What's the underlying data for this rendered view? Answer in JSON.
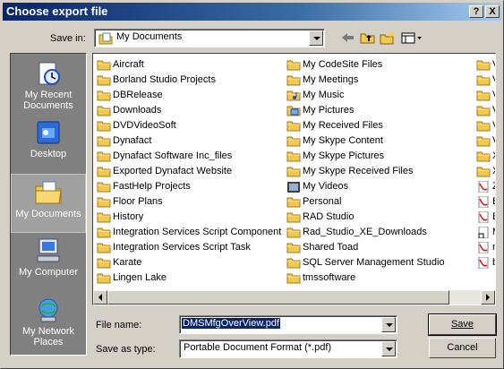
{
  "window": {
    "title": "Choose export file"
  },
  "title_buttons": {
    "help": "?",
    "close": "X"
  },
  "save_in": {
    "label": "Save in:",
    "value": "My Documents"
  },
  "toolbar": [
    "back-icon",
    "up-folder-icon",
    "new-folder-icon",
    "view-menu-icon"
  ],
  "places": [
    {
      "label": "My Recent Documents",
      "icon": "recent-documents-icon"
    },
    {
      "label": "Desktop",
      "icon": "desktop-icon"
    },
    {
      "label": "My Documents",
      "icon": "my-documents-icon"
    },
    {
      "label": "My Computer",
      "icon": "my-computer-icon"
    },
    {
      "label": "My Network Places",
      "icon": "network-places-icon"
    }
  ],
  "files": {
    "col1": [
      "Aircraft",
      "Borland Studio Projects",
      "DBRelease",
      "Downloads",
      "DVDVideoSoft",
      "Dynafact",
      "Dynafact Software Inc_files",
      "Exported Dynafact Website",
      "FastHelp Projects",
      "Floor Plans",
      "History",
      "Integration Services Script Component",
      "Integration Services Script Task",
      "Karate",
      "Lingen Lake"
    ],
    "col2": [
      {
        "name": "My CodeSite Files",
        "icon": "folder"
      },
      {
        "name": "My Meetings",
        "icon": "folder"
      },
      {
        "name": "My Music",
        "icon": "music"
      },
      {
        "name": "My Pictures",
        "icon": "pictures"
      },
      {
        "name": "My Received Files",
        "icon": "folder"
      },
      {
        "name": "My Skype Content",
        "icon": "folder"
      },
      {
        "name": "My Skype Pictures",
        "icon": "folder"
      },
      {
        "name": "My Skype Received Files",
        "icon": "folder"
      },
      {
        "name": "My Videos",
        "icon": "videos"
      },
      {
        "name": "Personal",
        "icon": "folder"
      },
      {
        "name": "RAD Studio",
        "icon": "folder"
      },
      {
        "name": "Rad_Studio_XE_Downloads",
        "icon": "folder"
      },
      {
        "name": "Shared Toad",
        "icon": "folder"
      },
      {
        "name": "SQL Server Management Studio",
        "icon": "folder"
      },
      {
        "name": "tmssoftware",
        "icon": "folder"
      }
    ],
    "col3_partial": [
      "folder",
      "folder",
      "folder",
      "folder",
      "folder",
      "folder",
      "folder",
      "folder",
      "pdf",
      "pdf",
      "pdf",
      "shortcut",
      "pdf",
      "pdf"
    ],
    "col3_letters": [
      "V",
      "V",
      "V",
      "V",
      "V",
      "V",
      "X",
      "X",
      "Z",
      "B",
      "B",
      "M",
      "n",
      "b"
    ]
  },
  "file_name": {
    "label": "File name:",
    "value": "DMSMfgOverView.pdf"
  },
  "save_as_type": {
    "label": "Save as type:",
    "value": "Portable Document Format (*.pdf)"
  },
  "buttons": {
    "save": "Save",
    "cancel": "Cancel"
  },
  "colors": {
    "title_start": "#0a246a",
    "title_end": "#a6caf0",
    "folder": "#f2c94c",
    "face": "#d4d0c8"
  }
}
